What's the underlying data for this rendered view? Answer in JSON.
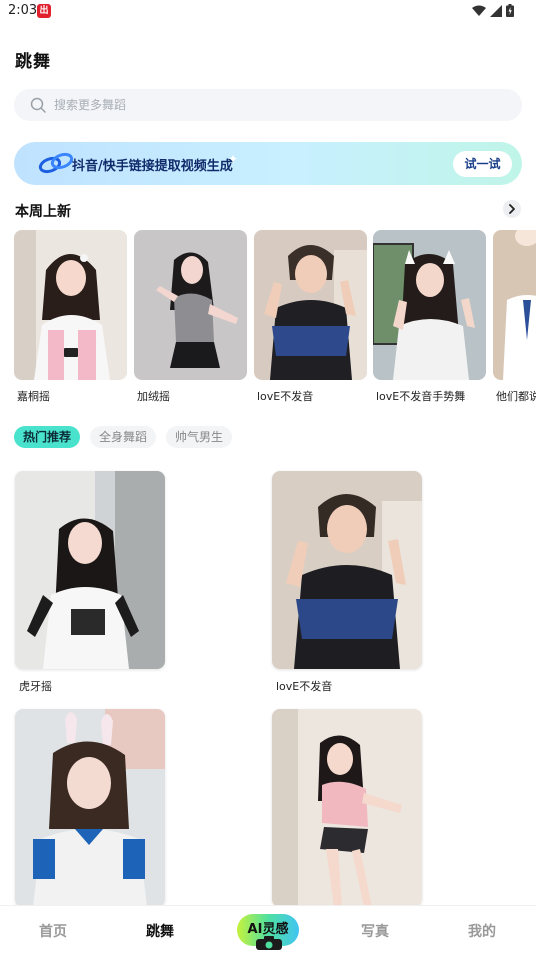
{
  "status_bar": {
    "time": "2:03",
    "app_icon_text": "出"
  },
  "header": {
    "title": "跳舞"
  },
  "search": {
    "placeholder": "搜索更多舞蹈"
  },
  "banner": {
    "text": "抖音/快手链接提取视频生成",
    "button_label": "试一试"
  },
  "weekly_new": {
    "title": "本周上新",
    "items": [
      {
        "label": "嘉桐摇"
      },
      {
        "label": "加绒摇"
      },
      {
        "label": "lovE不发音"
      },
      {
        "label": "lovE不发音手势舞"
      },
      {
        "label": "他们都说"
      }
    ]
  },
  "tabs": [
    {
      "label": "热门推荐",
      "active": true
    },
    {
      "label": "全身舞蹈",
      "active": false
    },
    {
      "label": "帅气男生",
      "active": false
    }
  ],
  "grid": {
    "items": [
      {
        "label": "虎牙摇"
      },
      {
        "label": "lovE不发音"
      },
      {
        "label": ""
      },
      {
        "label": ""
      }
    ]
  },
  "bottom_nav": {
    "home": "首页",
    "dance": "跳舞",
    "ai": "AI灵感",
    "photo": "写真",
    "mine": "我的"
  },
  "colors": {
    "accent": "#49e2cc",
    "banner_text": "#122b6b"
  }
}
